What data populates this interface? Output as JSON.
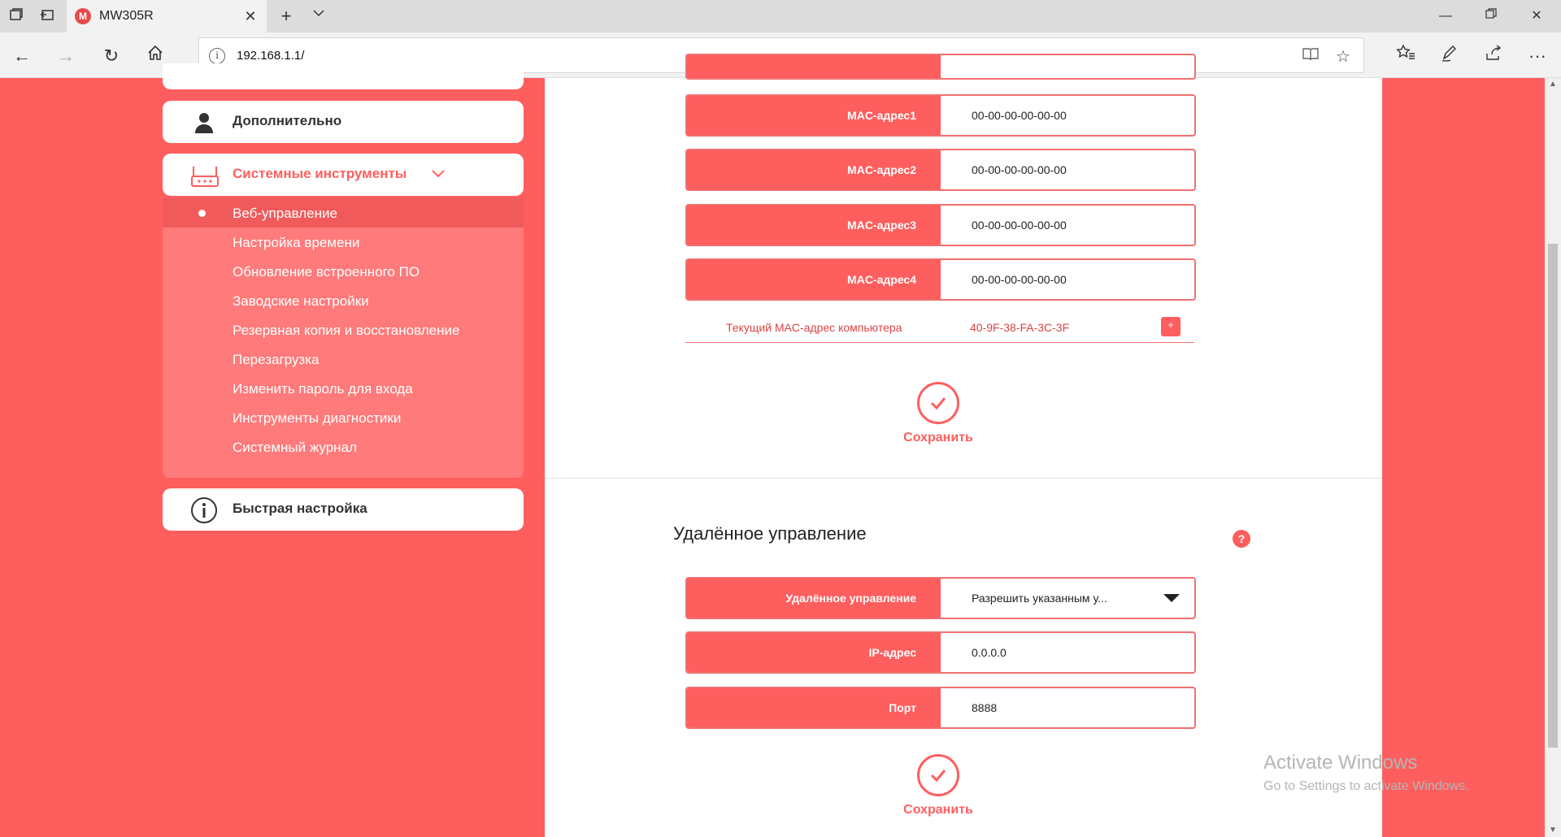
{
  "browser": {
    "tab_title": "MW305R",
    "tab_favicon_letter": "M",
    "url": "192.168.1.1/"
  },
  "sidebar": {
    "advanced_label": "Дополнительно",
    "system_tools_label": "Системные инструменты",
    "quick_setup_label": "Быстрая настройка",
    "submenu": [
      "Веб-управление",
      "Настройка времени",
      "Обновление встроенного ПО",
      "Заводские настройки",
      "Резервная копия и восстановление",
      "Перезагрузка",
      "Изменить пароль для входа",
      "Инструменты диагностики",
      "Системный журнал"
    ]
  },
  "mac_section": {
    "fields": [
      {
        "label": "MAC-адрес1",
        "value": "00-00-00-00-00-00"
      },
      {
        "label": "MAC-адрес2",
        "value": "00-00-00-00-00-00"
      },
      {
        "label": "MAC-адрес3",
        "value": "00-00-00-00-00-00"
      },
      {
        "label": "MAC-адрес4",
        "value": "00-00-00-00-00-00"
      }
    ],
    "current_mac_label": "Текущий MAC-адрес компьютера",
    "current_mac_value": "40-9F-38-FA-3C-3F",
    "add_symbol": "+",
    "save_label": "Сохранить"
  },
  "remote_section": {
    "title": "Удалённое управление",
    "help_symbol": "?",
    "mode_label": "Удалённое управление",
    "mode_value": "Разрешить указанным у...",
    "ip_label": "IP-адрес",
    "ip_value": "0.0.0.0",
    "port_label": "Порт",
    "port_value": "8888",
    "save_label": "Сохранить"
  },
  "watermark": {
    "line1": "Activate Windows",
    "line2": "Go to Settings to activate Windows."
  },
  "colors": {
    "brand": "#ff5e5e",
    "submenu_bg": "#ff7a7a",
    "selected_item": "#f05a5a"
  }
}
